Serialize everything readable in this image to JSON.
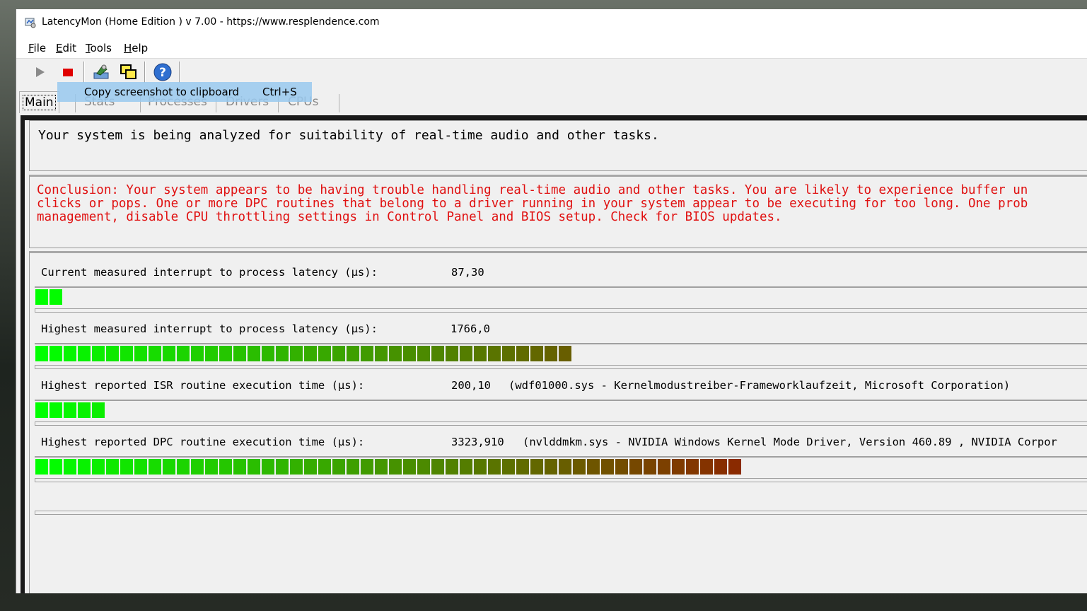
{
  "window": {
    "title": "LatencyMon  (Home Edition )  v 7.00 - https://www.resplendence.com"
  },
  "menu": [
    "File",
    "Edit",
    "Tools",
    "Help"
  ],
  "toolbar": {
    "icons": [
      "play-icon",
      "stop-icon",
      "settings-icon",
      "windows-icon",
      "help-icon"
    ]
  },
  "tabs": [
    "Main",
    "Stats",
    "Processes",
    "Drivers",
    "CPUs"
  ],
  "tooltip": {
    "label": "Copy screenshot to clipboard",
    "shortcut": "Ctrl+S"
  },
  "info": {
    "text": "Your system is being analyzed for suitability of real-time audio and other tasks."
  },
  "conclusion": {
    "lines": [
      "Conclusion: Your system appears to be having trouble handling real-time audio and other tasks. You are likely to experience buffer un",
      "clicks or pops. One or more DPC routines that belong to a driver running in your system appear to be executing for too long. One prob",
      "management, disable CPU throttling settings in Control Panel and BIOS setup. Check for BIOS updates."
    ]
  },
  "metrics": [
    {
      "label": "Current measured interrupt to process latency (µs):",
      "value": "87,30",
      "detail": "",
      "segments": 2
    },
    {
      "label": "Highest measured interrupt to process latency (µs):",
      "value": "1766,0",
      "detail": "",
      "segments": 38
    },
    {
      "label": "Highest reported ISR routine execution time (µs):",
      "value": "200,10",
      "detail": "(wdf01000.sys - Kernelmodustreiber-Frameworklaufzeit, Microsoft Corporation)",
      "segments": 5
    },
    {
      "label": "Highest reported DPC routine execution time (µs):",
      "value": "3323,910",
      "detail": "(nvlddmkm.sys - NVIDIA Windows Kernel Mode Driver, Version 460.89 , NVIDIA Corpor",
      "segments": 50
    }
  ],
  "colors": {
    "conclusion": "#e01010",
    "bar_start": "#00ff00",
    "bar_end": "#8a2a00"
  }
}
